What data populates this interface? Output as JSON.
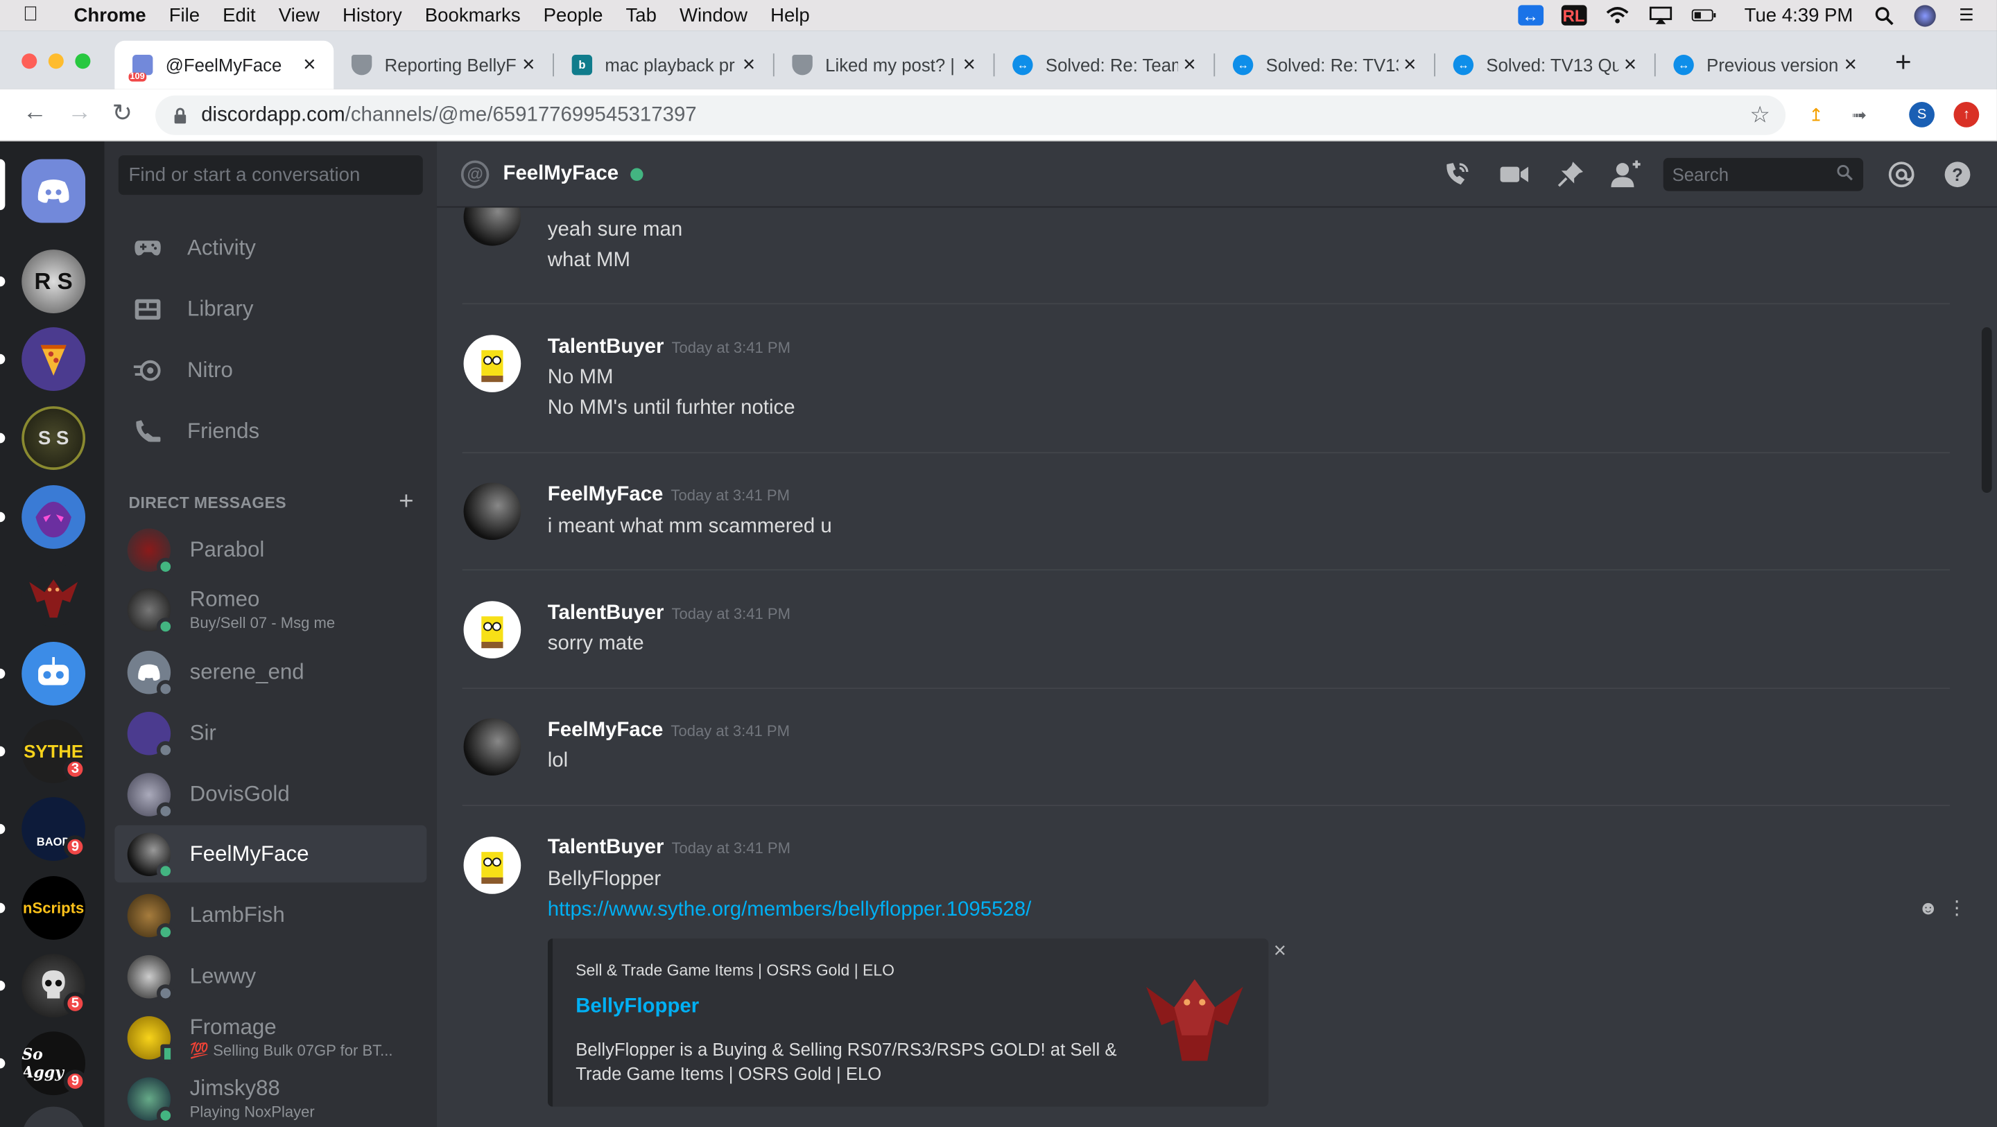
{
  "menubar": {
    "app": "Chrome",
    "items": [
      "File",
      "Edit",
      "View",
      "History",
      "Bookmarks",
      "People",
      "Tab",
      "Window",
      "Help"
    ],
    "clock": "Tue 4:39 PM"
  },
  "tabs": [
    {
      "title": "@FeelMyFace",
      "favicon": "discord-badge-icon",
      "badge": "109"
    },
    {
      "title": "Reporting BellyF",
      "favicon": "shield-icon"
    },
    {
      "title": "mac playback pr",
      "favicon": "bing-icon"
    },
    {
      "title": "Liked my post? |",
      "favicon": "shield-icon"
    },
    {
      "title": "Solved: Re: Team",
      "favicon": "teamviewer-icon"
    },
    {
      "title": "Solved: Re: TV13",
      "favicon": "teamviewer-icon"
    },
    {
      "title": "Solved: TV13 Qu",
      "favicon": "teamviewer-icon"
    },
    {
      "title": "Previous version",
      "favicon": "teamviewer-icon"
    }
  ],
  "address": {
    "host": "discordapp.com",
    "path": "/channels/@me/659177699545317397"
  },
  "profile_initial": "S",
  "guilds": [
    {
      "name": "home",
      "label": ""
    },
    {
      "name": "RS",
      "label": "R S"
    },
    {
      "name": "pizza",
      "label": ""
    },
    {
      "name": "SS",
      "label": "S S"
    },
    {
      "name": "purple-creature",
      "label": ""
    },
    {
      "name": "red-dragon",
      "label": ""
    },
    {
      "name": "robot",
      "label": ""
    },
    {
      "name": "sythe",
      "label": "SYTHE",
      "badge": "3"
    },
    {
      "name": "baod",
      "label": "BAOD",
      "badge": "9"
    },
    {
      "name": "nscripts",
      "label": "nScripts"
    },
    {
      "name": "skull",
      "label": "",
      "badge": "5"
    },
    {
      "name": "so-aggy",
      "label": "So Aggy",
      "badge": "9"
    }
  ],
  "sidebar": {
    "search_placeholder": "Find or start a conversation",
    "nav": [
      {
        "label": "Activity",
        "icon": "gamepad-icon"
      },
      {
        "label": "Library",
        "icon": "library-icon"
      },
      {
        "label": "Nitro",
        "icon": "nitro-icon"
      },
      {
        "label": "Friends",
        "icon": "friends-icon"
      }
    ],
    "dm_header": "DIRECT MESSAGES",
    "dms": [
      {
        "name": "Parabol",
        "sub": "",
        "status": "online"
      },
      {
        "name": "Romeo",
        "sub": "Buy/Sell 07 - Msg me",
        "status": "online"
      },
      {
        "name": "serene_end",
        "sub": "",
        "status": "offline"
      },
      {
        "name": "Sir",
        "sub": "",
        "status": "offline"
      },
      {
        "name": "DovisGold",
        "sub": "",
        "status": "offline"
      },
      {
        "name": "FeelMyFace",
        "sub": "",
        "status": "online"
      },
      {
        "name": "LambFish",
        "sub": "",
        "status": "online"
      },
      {
        "name": "Lewwy",
        "sub": "",
        "status": "offline"
      },
      {
        "name": "Fromage",
        "sub": "💯 Selling Bulk 07GP for BT...",
        "status": "mobile"
      },
      {
        "name": "Jimsky88",
        "sub": "Playing NoxPlayer",
        "status": "online"
      }
    ]
  },
  "channel": {
    "name": "FeelMyFace",
    "search_placeholder": "Search"
  },
  "messages": [
    {
      "author": "",
      "time": "",
      "lines": [
        "yeah sure man",
        "what MM"
      ]
    },
    {
      "author": "TalentBuyer",
      "time": "Today at 3:41 PM",
      "lines": [
        "No MM",
        "No MM's until furhter notice"
      ]
    },
    {
      "author": "FeelMyFace",
      "time": "Today at 3:41 PM",
      "lines": [
        "i meant what mm scammered u"
      ]
    },
    {
      "author": "TalentBuyer",
      "time": "Today at 3:41 PM",
      "lines": [
        "sorry mate"
      ]
    },
    {
      "author": "FeelMyFace",
      "time": "Today at 3:41 PM",
      "lines": [
        "lol"
      ]
    },
    {
      "author": "TalentBuyer",
      "time": "Today at 3:41 PM",
      "lines": [
        "BellyFlopper"
      ],
      "link": "https://www.sythe.org/members/bellyflopper.1095528/"
    }
  ],
  "embed": {
    "provider": "Sell & Trade Game Items | OSRS Gold | ELO",
    "title": "BellyFlopper",
    "description": "BellyFlopper is a Buying & Selling RS07/RS3/RSPS GOLD! at Sell & Trade Game Items | OSRS Gold | ELO"
  },
  "colors": {
    "blurple": "#7289da",
    "online": "#43b581",
    "offline": "#747f8d",
    "badge": "#f04747",
    "link": "#00b0f4"
  }
}
